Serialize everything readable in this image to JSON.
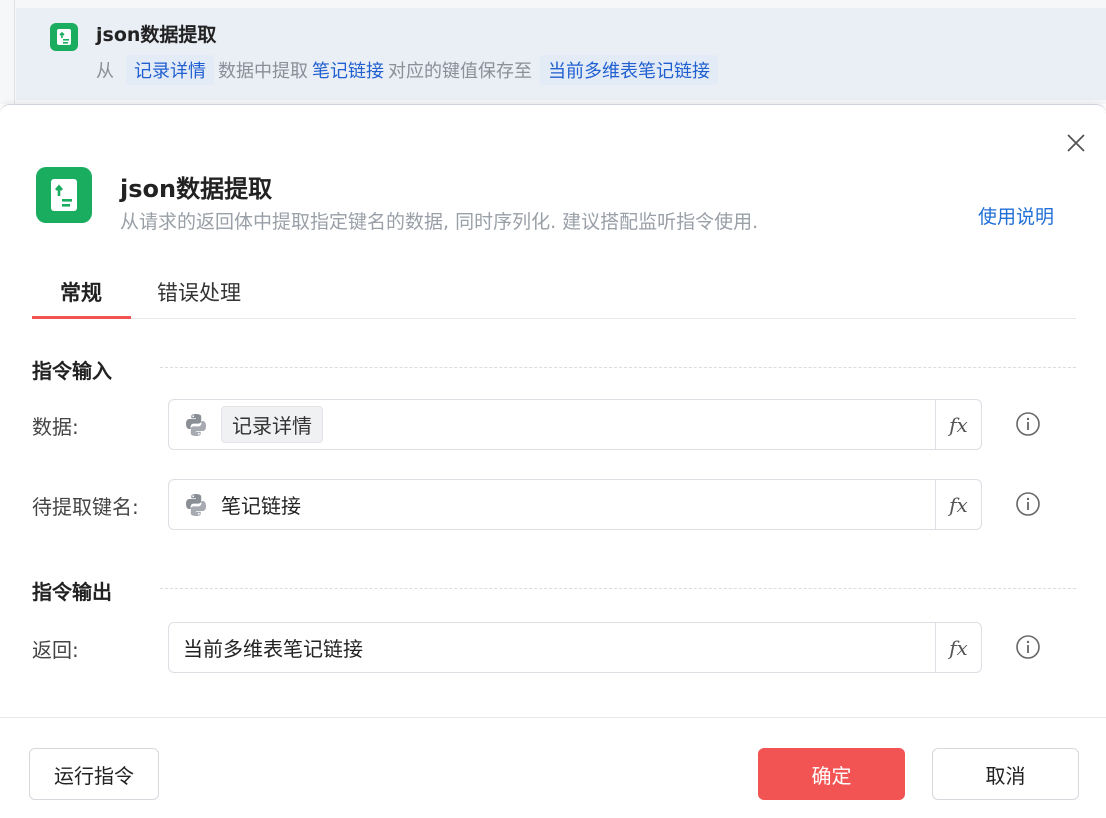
{
  "step": {
    "title": "json数据提取",
    "desc_from": "从",
    "desc_source": "记录详情",
    "desc_mid": "数据中提取",
    "desc_key": "笔记链接",
    "desc_save": "对应的键值保存至",
    "desc_target": "当前多维表笔记链接"
  },
  "dialog": {
    "title": "json数据提取",
    "description": "从请求的返回体中提取指定键名的数据, 同时序列化. 建议搭配监听指令使用.",
    "help_link": "使用说明"
  },
  "tabs": [
    {
      "label": "常规",
      "active": true
    },
    {
      "label": "错误处理",
      "active": false
    }
  ],
  "sections": {
    "input_title": "指令输入",
    "output_title": "指令输出"
  },
  "fields": {
    "data": {
      "label": "数据:",
      "value": "记录详情"
    },
    "key": {
      "label": "待提取键名:",
      "value": "笔记链接"
    },
    "return": {
      "label": "返回:",
      "value": "当前多维表笔记链接"
    },
    "fx_label": "fx"
  },
  "buttons": {
    "run": "运行指令",
    "ok": "确定",
    "cancel": "取消"
  },
  "colors": {
    "accent_red": "#f25454",
    "brand_green": "#1aac5f",
    "link_blue": "#1f6fd6"
  }
}
